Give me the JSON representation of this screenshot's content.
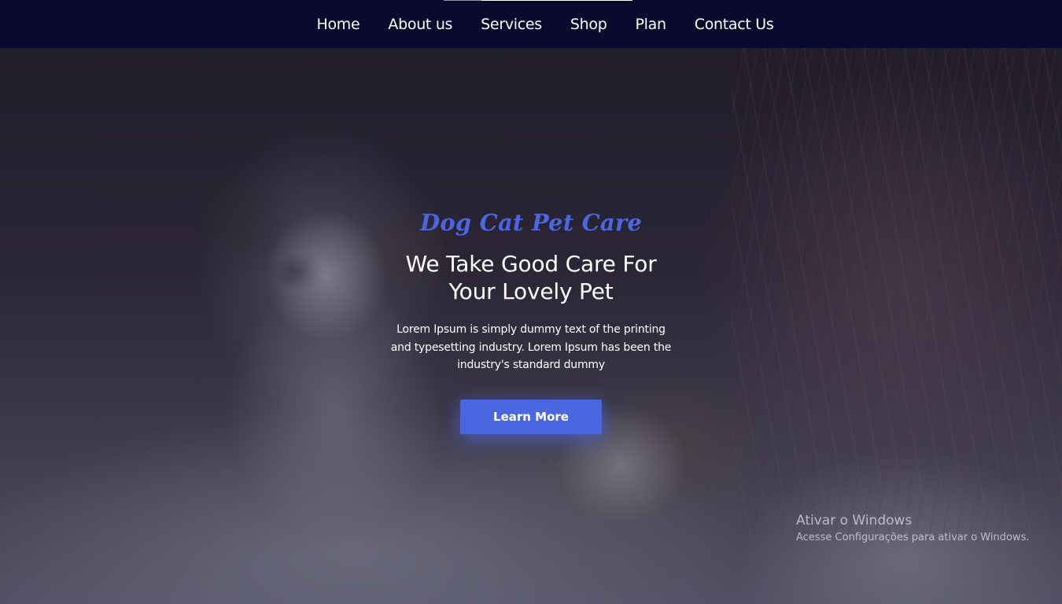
{
  "nav": {
    "items": [
      {
        "label": "Home"
      },
      {
        "label": "About us"
      },
      {
        "label": "Services"
      },
      {
        "label": "Shop"
      },
      {
        "label": "Plan"
      },
      {
        "label": "Contact Us"
      }
    ]
  },
  "hero": {
    "subtitle": "Dog Cat Pet Care",
    "title_line1": "We Take Good Care For",
    "title_line2": "Your Lovely Pet",
    "text": "Lorem Ipsum is simply dummy text of the printing and typesetting industry. Lorem Ipsum has been the industry's standard dummy",
    "button_label": "Learn More"
  },
  "watermark": {
    "title": "Ativar o Windows",
    "subtitle": "Acesse Configurações para ativar o Windows."
  },
  "colors": {
    "nav_bg": "#0a0a2e",
    "accent": "#4a66e0",
    "text": "#ffffff"
  }
}
